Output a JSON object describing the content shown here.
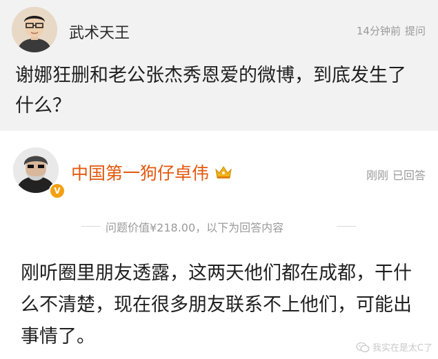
{
  "question": {
    "asker_name": "武术天王",
    "time": "14分钟前",
    "action": "提问",
    "text": "谢娜狂删和老公张杰秀恩爱的微博，到底发生了什么？"
  },
  "answer": {
    "answerer_name": "中国第一狗仔卓伟",
    "time": "刚刚",
    "status": "已回答",
    "verified_badge": "V",
    "price_divider": "问题价值¥218.00，以下为回答内容",
    "text": "刚听圈里朋友透露，这两天他们都在成都，干什么不清楚，现在很多朋友联系不上他们，可能出事情了。"
  },
  "watermark": {
    "text": "我实在是太C了"
  },
  "icons": {
    "crown": "crown-icon",
    "verified": "verified-badge-icon",
    "watermark": "wechat-icon"
  },
  "colors": {
    "question_bg": "#f2f2f2",
    "answerer_name": "#e2580e",
    "meta_gray": "#9a9a9a",
    "badge_orange": "#f3a013"
  }
}
